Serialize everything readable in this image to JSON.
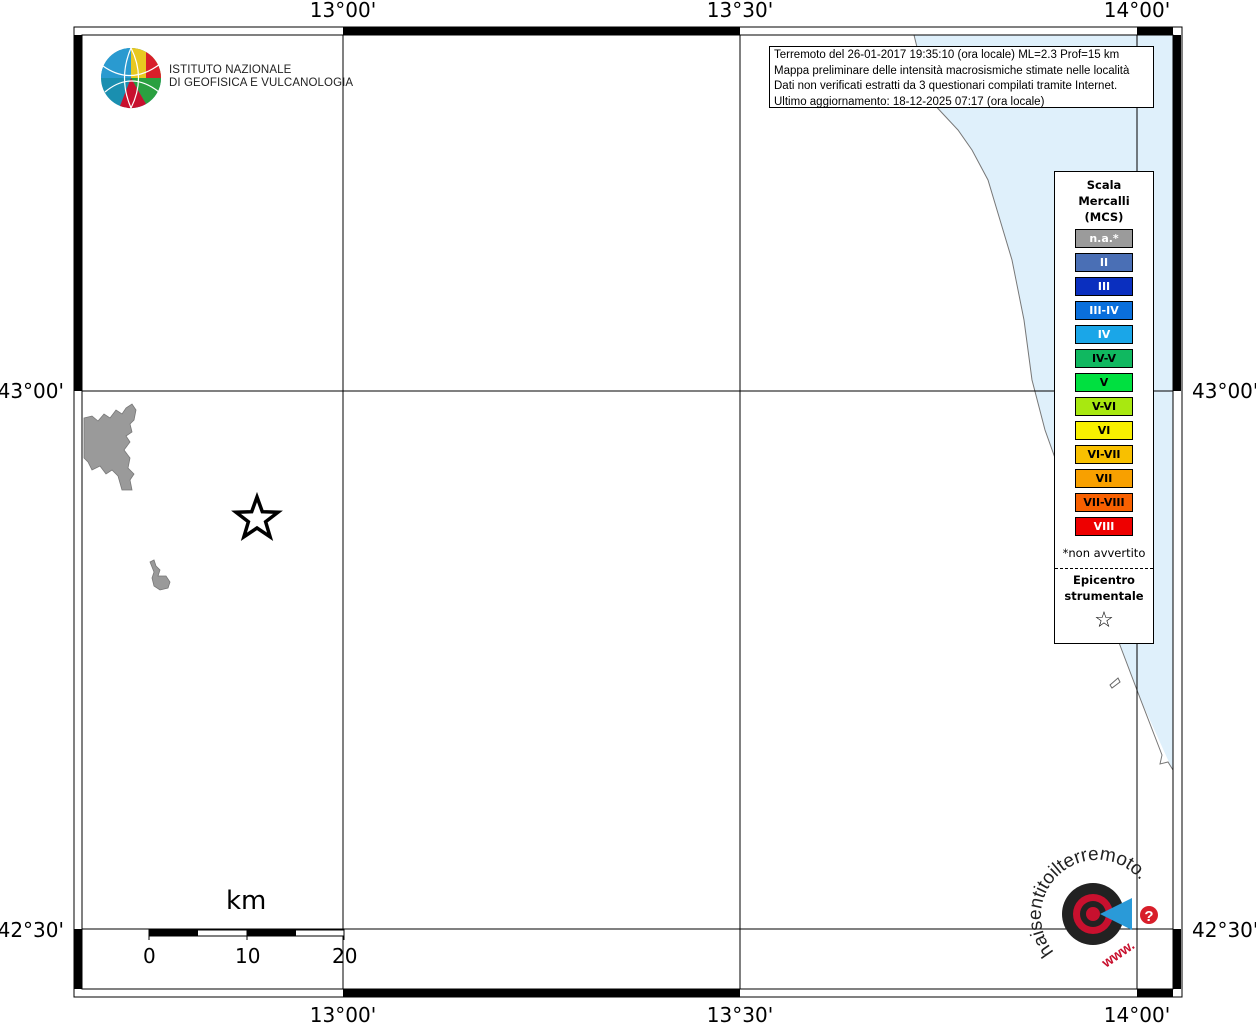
{
  "map": {
    "lon_labels": [
      "13°00'",
      "13°30'",
      "14°00'"
    ],
    "lat_labels": [
      "43°00'",
      "42°30'"
    ],
    "coast_color": "#dff0fb",
    "land_color": "#9a9a9a"
  },
  "info_box": {
    "line1": "Terremoto del 26-01-2017 19:35:10 (ora locale) ML=2.3 Prof=15 km",
    "line2": "Mappa preliminare delle intensità macrosismiche stimate nelle località",
    "line3": "Dati non verificati estratti da 3 questionari compilati tramite Internet.",
    "line4": "Ultimo aggiornamento: 18-12-2025 07:17 (ora locale)"
  },
  "logo": {
    "line1": "ISTITUTO NAZIONALE",
    "line2": "DI GEOFISICA E VULCANOLOGIA"
  },
  "legend": {
    "title1": "Scala",
    "title2": "Mercalli",
    "title3": "(MCS)",
    "items": [
      {
        "label": "n.a.*",
        "color": "#9b9b9b",
        "text_color": "#ffffff"
      },
      {
        "label": "II",
        "color": "#4a6fb5",
        "text_color": "#ffffff"
      },
      {
        "label": "III",
        "color": "#0a2fbf",
        "text_color": "#ffffff"
      },
      {
        "label": "III-IV",
        "color": "#0a6fdc",
        "text_color": "#ffffff"
      },
      {
        "label": "IV",
        "color": "#1aa6e8",
        "text_color": "#ffffff"
      },
      {
        "label": "IV-V",
        "color": "#10b860",
        "text_color": "#000000"
      },
      {
        "label": "V",
        "color": "#00e040",
        "text_color": "#000000"
      },
      {
        "label": "V-VI",
        "color": "#a8e810",
        "text_color": "#000000"
      },
      {
        "label": "VI",
        "color": "#f8f000",
        "text_color": "#000000"
      },
      {
        "label": "VI-VII",
        "color": "#f8c000",
        "text_color": "#000000"
      },
      {
        "label": "VII",
        "color": "#f8a000",
        "text_color": "#000000"
      },
      {
        "label": "VII-VIII",
        "color": "#f86000",
        "text_color": "#000000"
      },
      {
        "label": "VIII",
        "color": "#ee0000",
        "text_color": "#ffffff"
      }
    ],
    "footnote": "*non avvertito",
    "epicenter_line1": "Epicentro",
    "epicenter_line2": "strumentale",
    "epicenter_symbol": "☆"
  },
  "scale_bar": {
    "unit": "km",
    "ticks": [
      "0",
      "10",
      "20"
    ]
  },
  "site_logo": {
    "text": "haisentitoilterremoto.it",
    "www": "www.",
    "question": "?"
  }
}
